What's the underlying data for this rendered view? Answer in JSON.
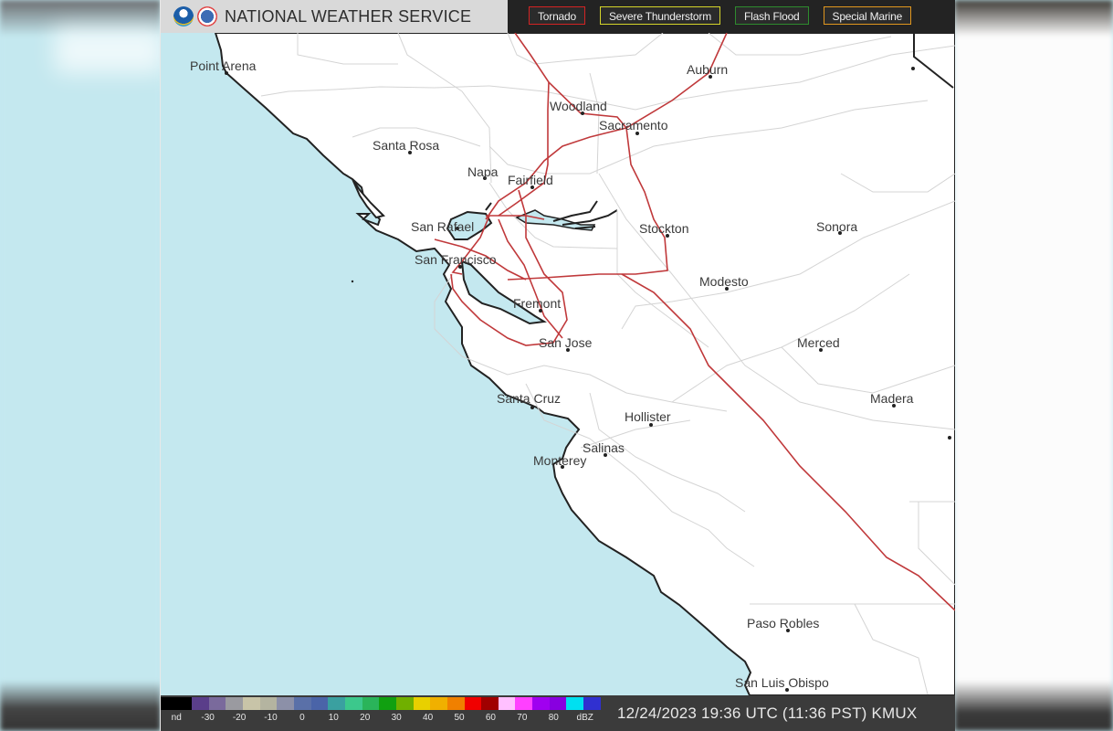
{
  "header": {
    "title": "NATIONAL WEATHER SERVICE",
    "logos": [
      "noaa-logo",
      "nws-logo"
    ],
    "legend": [
      {
        "label": "Tornado",
        "color": "#d32323"
      },
      {
        "label": "Severe Thunderstorm",
        "color": "#d4d42a"
      },
      {
        "label": "Flash Flood",
        "color": "#2e8b2e"
      },
      {
        "label": "Special Marine",
        "color": "#e0961e"
      }
    ]
  },
  "map": {
    "ocean_color": "#c4e8ef",
    "land_color": "#ffffff",
    "highway_color": "#c0393b",
    "cities": [
      {
        "name": "Point Arena"
      },
      {
        "name": "Santa Rosa"
      },
      {
        "name": "Napa"
      },
      {
        "name": "Fairfield"
      },
      {
        "name": "Woodland"
      },
      {
        "name": "Sacramento"
      },
      {
        "name": "Auburn"
      },
      {
        "name": "San Rafael"
      },
      {
        "name": "San Francisco"
      },
      {
        "name": "Stockton"
      },
      {
        "name": "Sonora"
      },
      {
        "name": "Modesto"
      },
      {
        "name": "Fremont"
      },
      {
        "name": "San Jose"
      },
      {
        "name": "Merced"
      },
      {
        "name": "Santa Cruz"
      },
      {
        "name": "Madera"
      },
      {
        "name": "Hollister"
      },
      {
        "name": "Salinas"
      },
      {
        "name": "Monterey"
      },
      {
        "name": "Paso Robles"
      },
      {
        "name": "San Luis Obispo"
      }
    ]
  },
  "footer": {
    "scale_ticks": [
      "nd",
      "-30",
      "-20",
      "-10",
      "0",
      "10",
      "20",
      "30",
      "40",
      "50",
      "60",
      "70",
      "80",
      "dBZ"
    ],
    "scale_colors": [
      "#000000",
      "#5a3e8a",
      "#7a6a9c",
      "#9a9aa0",
      "#c8c4a8",
      "#b4b4a0",
      "#8c90a8",
      "#5a70a8",
      "#4a64a8",
      "#3aa0a0",
      "#3cc88c",
      "#2ab45a",
      "#10a010",
      "#70b000",
      "#e8d000",
      "#f0b000",
      "#f08000",
      "#f00000",
      "#a00000",
      "#ffc0ff",
      "#ff40ff",
      "#a000f0",
      "#8800e0",
      "#00e0f0",
      "#3030d0"
    ],
    "timestamp": "12/24/2023 19:36 UTC (11:36 PST) KMUX"
  }
}
